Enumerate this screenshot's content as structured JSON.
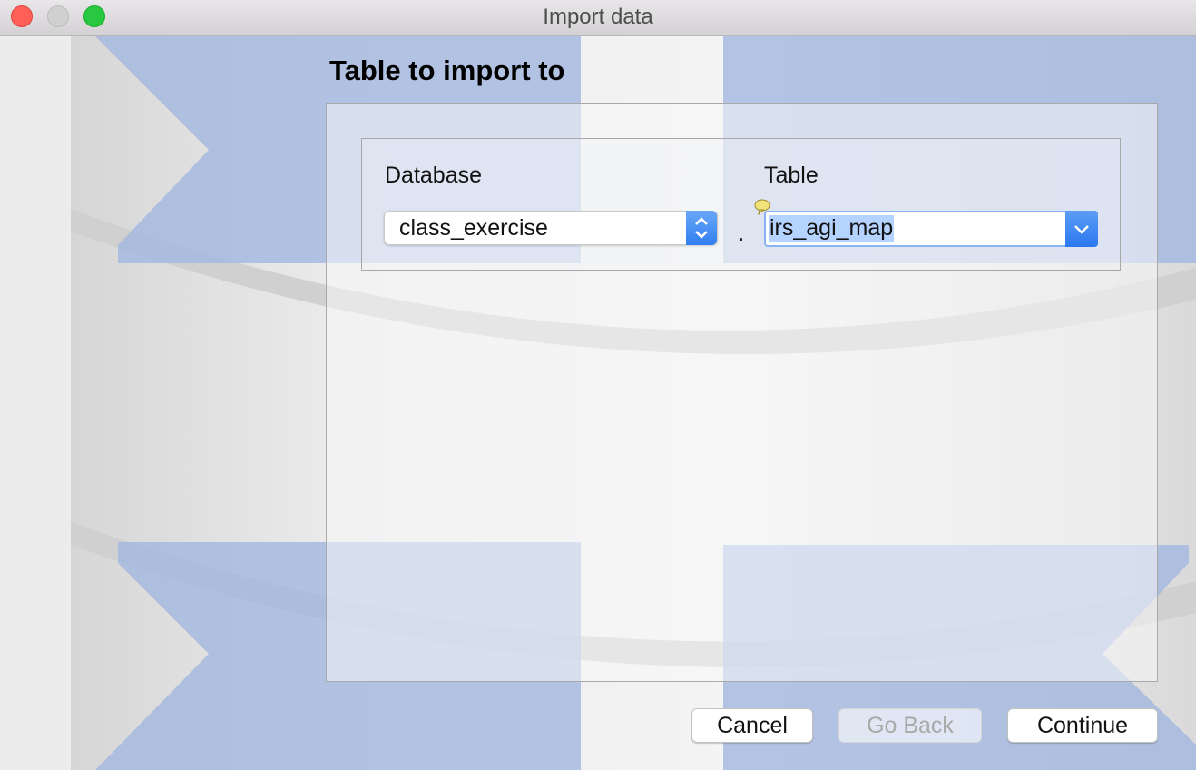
{
  "window": {
    "title": "Import data",
    "controls": [
      "close",
      "minimize",
      "zoom"
    ]
  },
  "heading": "Table to import to",
  "form": {
    "database_label": "Database",
    "database_value": "class_exercise",
    "separator": ".",
    "table_label": "Table",
    "table_value": "irs_agi_map"
  },
  "buttons": {
    "cancel": "Cancel",
    "go_back": "Go Back",
    "continue": "Continue"
  },
  "colors": {
    "accent": "#2f7ff0",
    "selection": "#b5d3ff",
    "art_blue": "#a3b7de"
  },
  "icons": {
    "database_stepper": "up-down-chevron-icon",
    "table_dropdown": "chevron-down-icon",
    "hint": "speech-bubble-icon",
    "background": "database-cylinder-illustration"
  }
}
